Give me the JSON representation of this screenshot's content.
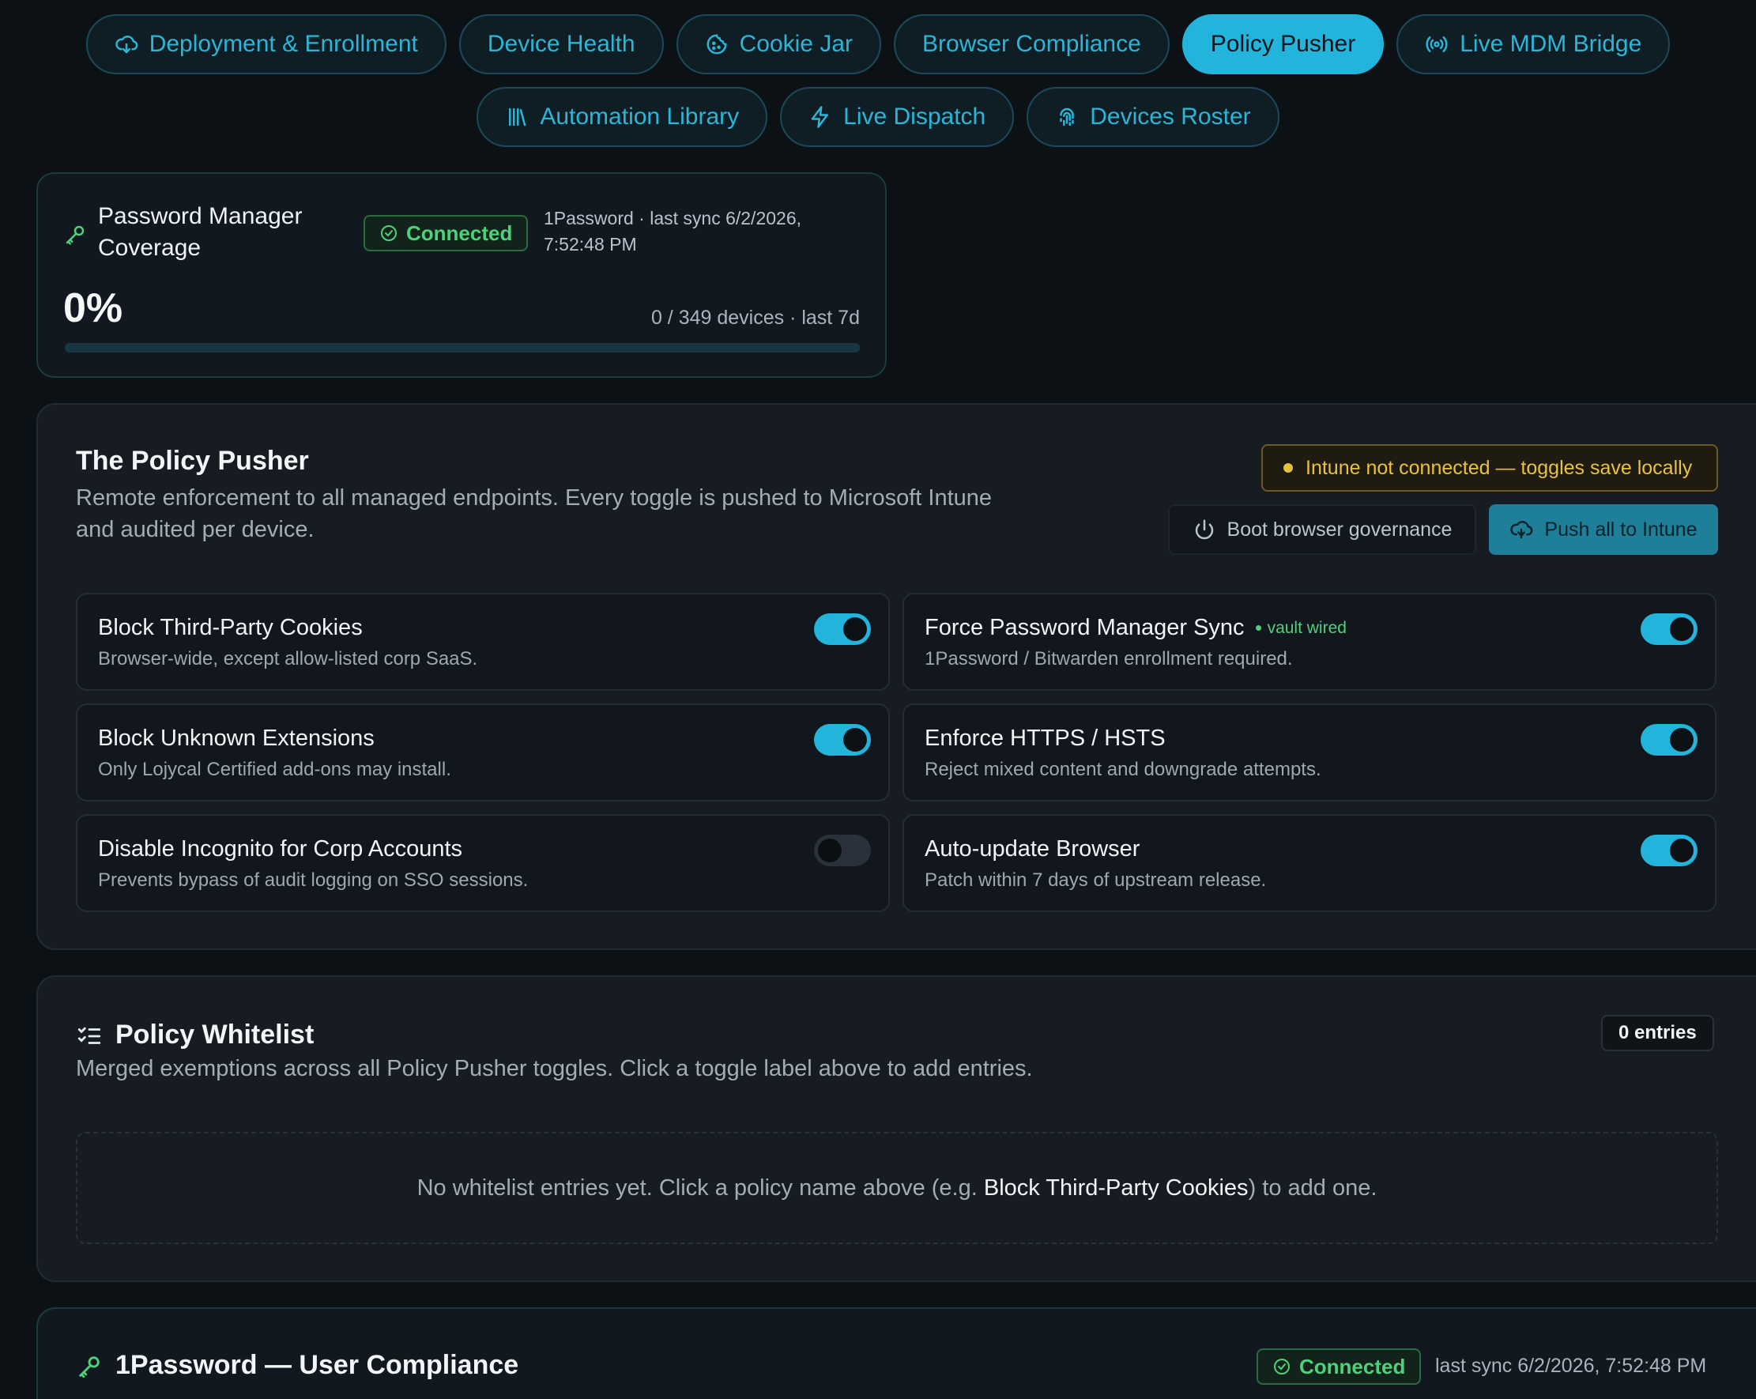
{
  "tabs_row1": [
    {
      "label": "Deployment & Enrollment",
      "icon": "cloud-download-icon"
    },
    {
      "label": "Device Health"
    },
    {
      "label": "Cookie Jar",
      "icon": "cookie-icon"
    },
    {
      "label": "Browser Compliance"
    },
    {
      "label": "Policy Pusher",
      "active": true
    },
    {
      "label": "Live MDM Bridge",
      "icon": "broadcast-icon"
    }
  ],
  "tabs_row2": [
    {
      "label": "Automation Library",
      "icon": "library-icon"
    },
    {
      "label": "Live Dispatch",
      "icon": "lightning-icon"
    },
    {
      "label": "Devices Roster",
      "icon": "fingerprint-icon"
    }
  ],
  "coverage": {
    "title": "Password Manager Coverage",
    "status": "Connected",
    "sync": "1Password · last sync 6/2/2026, 7:52:48 PM",
    "percent_label": "0%",
    "percent_value": 0,
    "count": "0 / 349 devices · last 7d"
  },
  "policy_pusher": {
    "title": "The Policy Pusher",
    "description": "Remote enforcement to all managed endpoints. Every toggle is pushed to Microsoft Intune and audited per device.",
    "warning": "Intune not connected — toggles save locally",
    "boot_label": "Boot browser governance",
    "push_label": "Push all to Intune",
    "toggles": [
      {
        "label": "Block Third-Party Cookies",
        "desc": "Browser-wide, except allow-listed corp SaaS.",
        "on": true
      },
      {
        "label": "Force Password Manager Sync",
        "desc": "1Password / Bitwarden enrollment required.",
        "on": true,
        "tag": "vault wired"
      },
      {
        "label": "Block Unknown Extensions",
        "desc": "Only Lojycal Certified add-ons may install.",
        "on": true
      },
      {
        "label": "Enforce HTTPS / HSTS",
        "desc": "Reject mixed content and downgrade attempts.",
        "on": true
      },
      {
        "label": "Disable Incognito for Corp Accounts",
        "desc": "Prevents bypass of audit logging on SSO sessions.",
        "on": false
      },
      {
        "label": "Auto-update Browser",
        "desc": "Patch within 7 days of upstream release.",
        "on": true
      }
    ]
  },
  "whitelist": {
    "title": "Policy Whitelist",
    "description": "Merged exemptions across all Policy Pusher toggles. Click a toggle label above to add entries.",
    "entries": "0 entries",
    "empty_prefix": "No whitelist entries yet. Click a policy name above (e.g. ",
    "empty_strong": "Block Third-Party Cookies",
    "empty_suffix": ") to add one."
  },
  "onepassword": {
    "title": "1Password — User Compliance",
    "status": "Connected",
    "sync": "last sync 6/2/2026, 7:52:48 PM"
  },
  "colors": {
    "accent": "#22b4db",
    "ok": "#4fd07a",
    "warn": "#e8c23c",
    "bg": "#0c1116"
  }
}
